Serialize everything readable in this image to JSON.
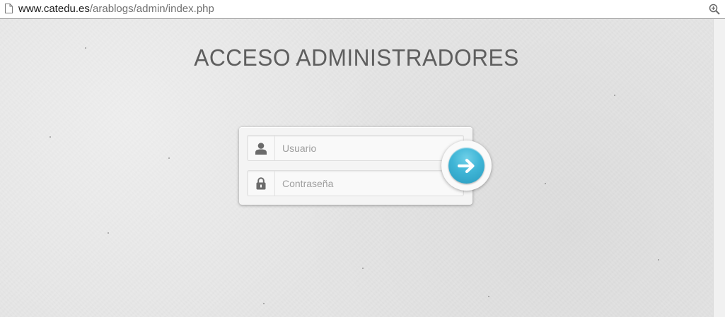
{
  "browser": {
    "url_host": "www.catedu.es",
    "url_path": "/arablogs/admin/index.php",
    "page_icon": "page-icon",
    "zoom_icon": "zoom-icon"
  },
  "page": {
    "title": "ACCESO ADMINISTRADORES"
  },
  "login": {
    "username": {
      "placeholder": "Usuario",
      "value": "",
      "icon": "user-icon"
    },
    "password": {
      "placeholder": "Contraseña",
      "value": "",
      "icon": "lock-icon"
    },
    "submit": {
      "icon": "arrow-right-icon"
    }
  },
  "colors": {
    "background": "#e6e6e6",
    "title": "#5e5e5e",
    "submit_button": "#3fb5d6"
  }
}
